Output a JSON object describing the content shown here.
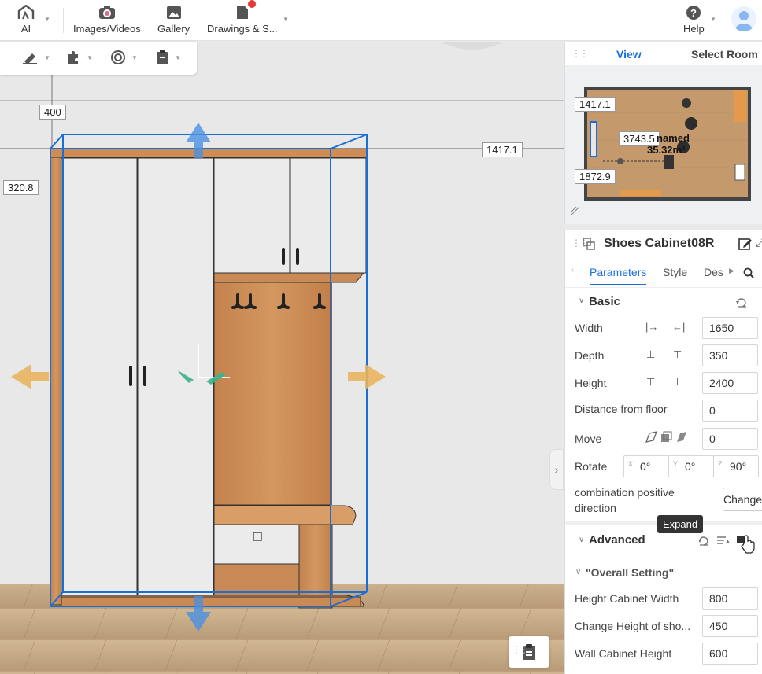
{
  "toolbar": {
    "ai_label": "AI",
    "images_label": "Images/Videos",
    "gallery_label": "Gallery",
    "drawings_label": "Drawings & S...",
    "help_label": "Help"
  },
  "viewport": {
    "dim_top": "400",
    "dim_right": "1417.1",
    "dim_left": "320.8"
  },
  "minimap": {
    "tab_view": "View",
    "tab_select_room": "Select Room",
    "dim_1": "1417.1",
    "dim_2": "3743.5",
    "room_name": "named",
    "room_area": "35.32m²",
    "dim_3": "1872.9"
  },
  "props": {
    "object_name": "Shoes Cabinet08R",
    "tabs": [
      "Parameters",
      "Style",
      "Des"
    ],
    "basic_title": "Basic",
    "width_label": "Width",
    "width_value": "1650",
    "depth_label": "Depth",
    "depth_value": "350",
    "height_label": "Height",
    "height_value": "2400",
    "floor_label": "Distance from floor",
    "floor_value": "0",
    "move_label": "Move",
    "move_value": "0",
    "rotate_label": "Rotate",
    "rotate_x_axis": "X",
    "rotate_x": "0°",
    "rotate_y_axis": "Y",
    "rotate_y": "0°",
    "rotate_z_axis": "Z",
    "rotate_z": "90°",
    "combination_label_1": "combination positive",
    "combination_label_2": "direction",
    "change_button": "Change",
    "tooltip": "Expand",
    "advanced_title": "Advanced",
    "overall_title": "\"Overall Setting\"",
    "hcw_label": "Height Cabinet Width",
    "hcw_value": "800",
    "chs_label": "Change Height of sho...",
    "chs_value": "450",
    "wch_label": "Wall Cabinet Height",
    "wch_value": "600"
  },
  "colors": {
    "accent": "#1a6fd6",
    "wood": "#c98a55",
    "wood_dark": "#9a5d30",
    "arrow_blue": "#4a90e2",
    "arrow_orange": "#e9b45f",
    "notify": "#e53935"
  }
}
